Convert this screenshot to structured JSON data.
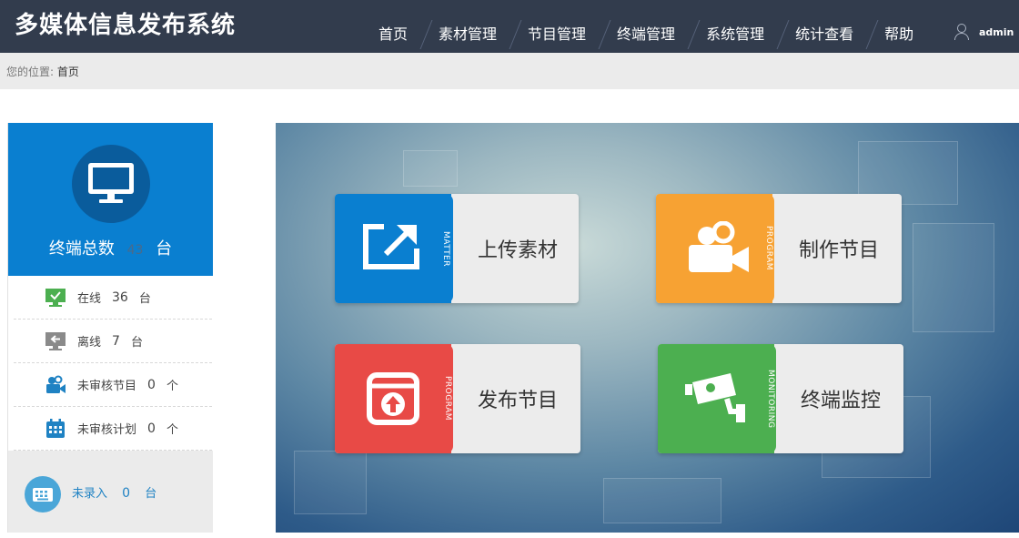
{
  "app": {
    "title": "多媒体信息发布系统"
  },
  "nav": {
    "items": [
      "首页",
      "素材管理",
      "节目管理",
      "终端管理",
      "系统管理",
      "统计查看",
      "帮助"
    ]
  },
  "user": {
    "name": "admin",
    "icon": "user-icon"
  },
  "breadcrumb": {
    "prefix": "您的位置:",
    "current": "首页"
  },
  "summary": {
    "label": "终端总数",
    "count": "43",
    "unit": "台",
    "icon": "monitor-icon"
  },
  "stats": [
    {
      "label": "在线",
      "value": "36",
      "unit": "台",
      "icon": "online-monitor-icon",
      "color": "#4caf50"
    },
    {
      "label": "离线",
      "value": "7",
      "unit": "台",
      "icon": "offline-monitor-icon",
      "color": "#888888"
    },
    {
      "label": "未审核节目",
      "value": "0",
      "unit": "个",
      "icon": "camera-icon",
      "color": "#1f82c3"
    },
    {
      "label": "未审核计划",
      "value": "0",
      "unit": "个",
      "icon": "calendar-icon",
      "color": "#1f82c3"
    }
  ],
  "pending": {
    "label": "未录入",
    "value": "0",
    "unit": "台",
    "icon": "keyboard-icon"
  },
  "tiles": [
    {
      "label": "上传素材",
      "tag": "MATTER",
      "color": "#0a7fd0",
      "icon": "upload-icon"
    },
    {
      "label": "制作节目",
      "tag": "PROGRAM",
      "color": "#f7a233",
      "icon": "video-camera-icon"
    },
    {
      "label": "发布节目",
      "tag": "PROGRAM",
      "color": "#e84a46",
      "icon": "publish-icon"
    },
    {
      "label": "终端监控",
      "tag": "MONITORING",
      "color": "#4caf50",
      "icon": "cctv-icon"
    }
  ]
}
